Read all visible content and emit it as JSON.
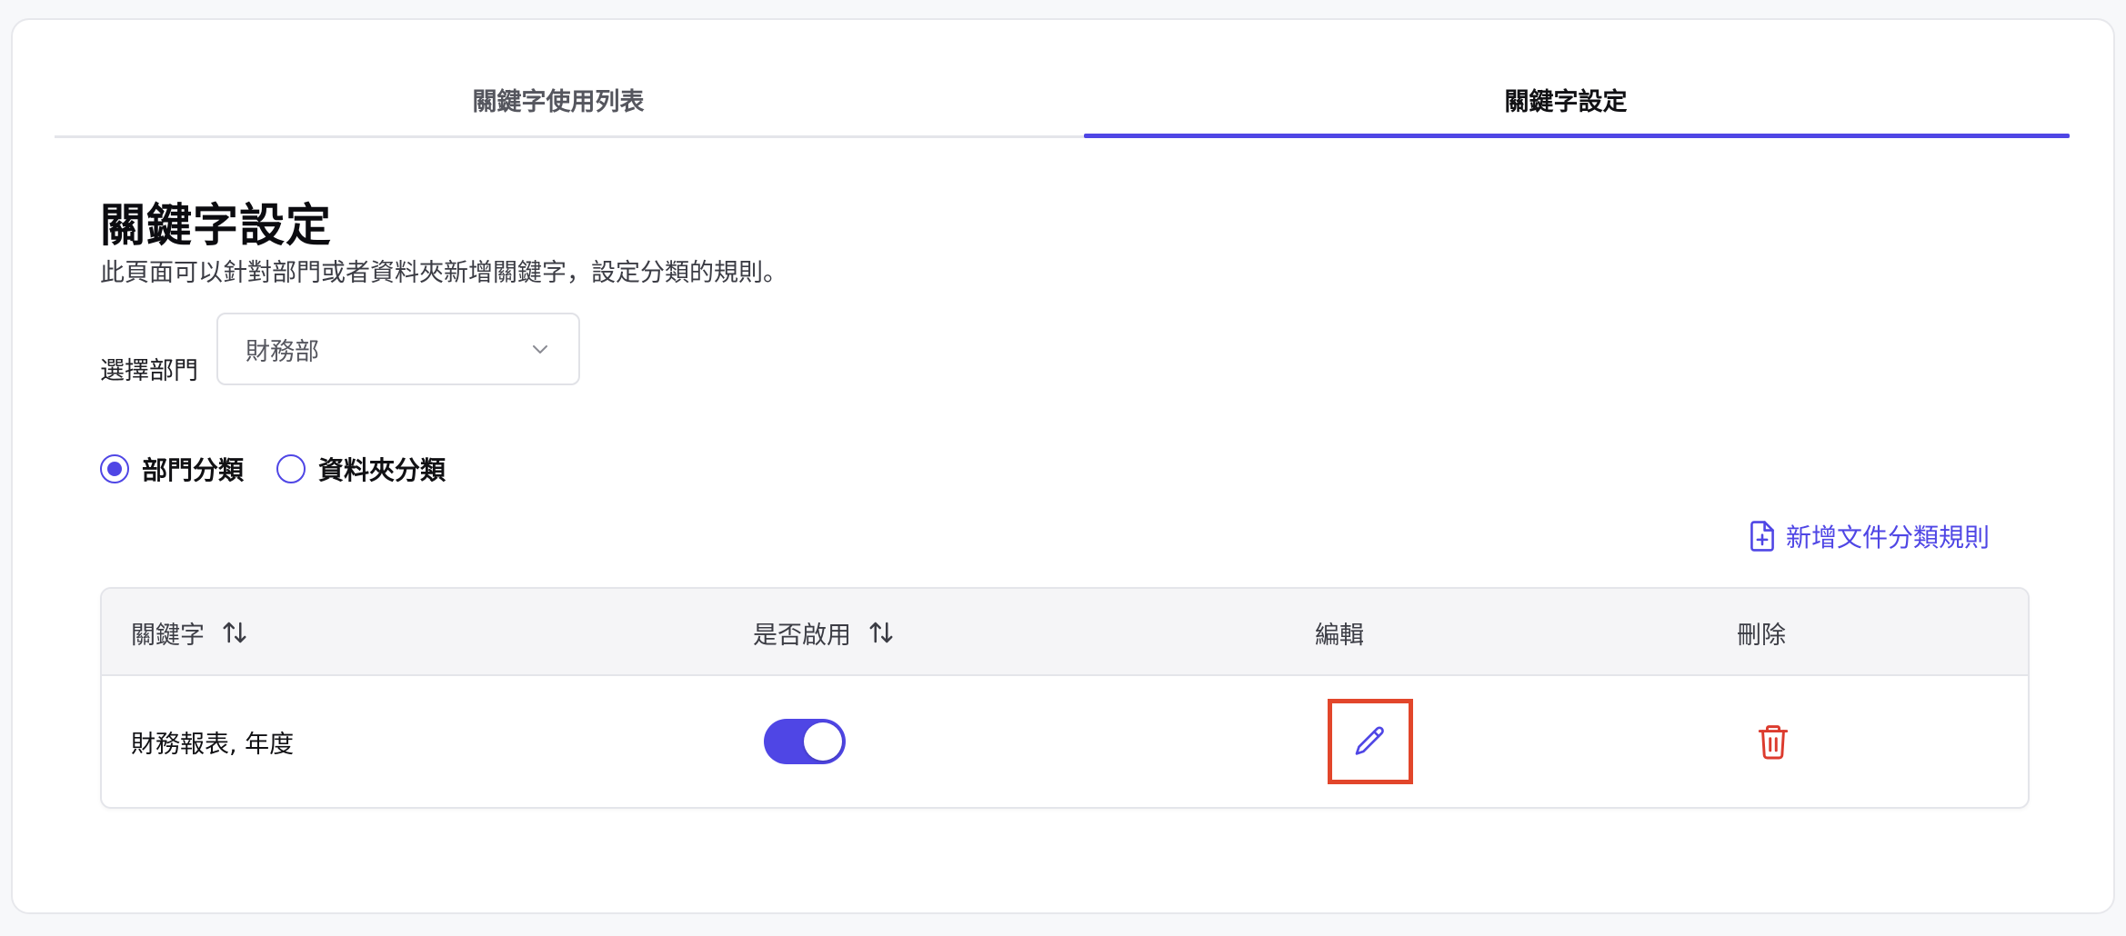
{
  "tabs": [
    {
      "label": "關鍵字使用列表",
      "active": false
    },
    {
      "label": "關鍵字設定",
      "active": true
    }
  ],
  "header": {
    "title": "關鍵字設定",
    "description": "此頁面可以針對部門或者資料夾新增關鍵字，設定分類的規則。"
  },
  "department": {
    "label": "選擇部門",
    "selected": "財務部"
  },
  "classification": {
    "options": [
      {
        "label": "部門分類",
        "checked": true
      },
      {
        "label": "資料夾分類",
        "checked": false
      }
    ]
  },
  "actions": {
    "add_rule_label": "新增文件分類規則"
  },
  "table": {
    "columns": {
      "keyword": "關鍵字",
      "enabled": "是否啟用",
      "edit": "編輯",
      "delete": "刪除"
    },
    "rows": [
      {
        "keyword": "財務報表, 年度",
        "enabled": true
      }
    ]
  },
  "colors": {
    "accent": "#4f46e5",
    "danger": "#dc3b2e",
    "highlight": "#e2462b"
  }
}
